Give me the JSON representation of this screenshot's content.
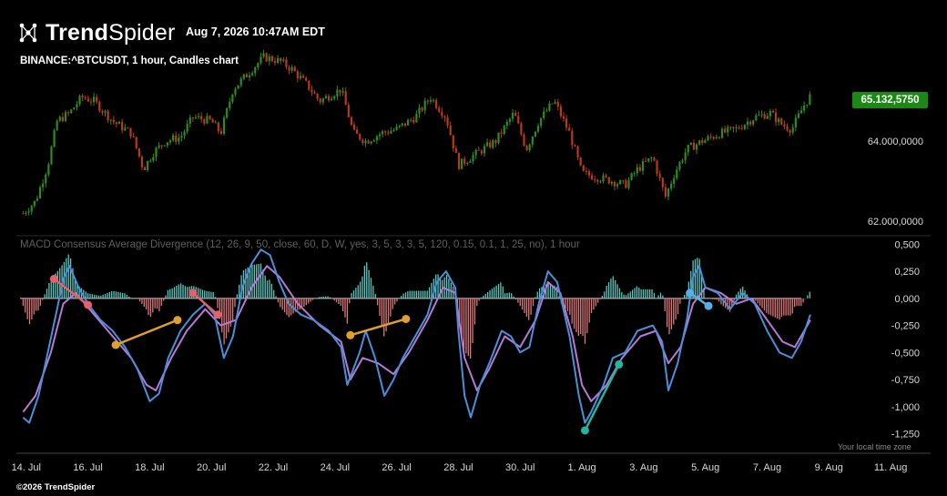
{
  "header": {
    "brand_bold": "Trend",
    "brand_light": "Spider",
    "brand_icon": "network-nodes-icon",
    "datetime": "Aug 7, 2026 10:47AM EDT",
    "symbol_title": "BINANCE:^BTCUSDT, 1 hour, Candles chart"
  },
  "footer": {
    "timezone_note": "Your local time zone",
    "copyright": "©2026 TrendSpider"
  },
  "colors": {
    "background": "#000000",
    "candle_up": "#2e8b1d",
    "candle_down": "#b83a1a",
    "hist_positive": "#59c9c0",
    "hist_negative": "#e0787a",
    "macd_line": "#4a90d9",
    "signal_line": "#b879d6",
    "price_badge": "#1b8a14",
    "div_red": "#e4606e",
    "div_orange": "#e0a030",
    "div_teal": "#23b59d",
    "div_blue": "#5aaee8"
  },
  "chart_data": [
    {
      "type": "candlestick",
      "title": "BINANCE:^BTCUSDT, 1 hour, Candles chart",
      "y_axis_side": "right",
      "y_ticks": [
        "64.000,0000",
        "62.000,0000"
      ],
      "y_tick_values": [
        64000,
        62000
      ],
      "ylim": [
        61800,
        66500
      ],
      "last_price_label": "65.132,5750",
      "last_price": 65132.575,
      "x_ticks": [
        "14. Jul",
        "16. Jul",
        "18. Jul",
        "20. Jul",
        "22. Jul",
        "24. Jul",
        "26. Jul",
        "28. Jul",
        "30. Jul",
        "1. Aug",
        "3. Aug",
        "5. Aug",
        "7. Aug",
        "9. Aug",
        "11. Aug"
      ],
      "x_tick_days": [
        0,
        2,
        4,
        6,
        8,
        10,
        12,
        14,
        16,
        18,
        20,
        22,
        24,
        26,
        28
      ],
      "x_range_days": [
        -0.2,
        29
      ],
      "close_path": [
        {
          "day": -0.1,
          "close": 62200
        },
        {
          "day": 0.3,
          "close": 62500
        },
        {
          "day": 0.7,
          "close": 63400
        },
        {
          "day": 1.0,
          "close": 64500
        },
        {
          "day": 1.4,
          "close": 64700
        },
        {
          "day": 1.8,
          "close": 65100
        },
        {
          "day": 2.2,
          "close": 65000
        },
        {
          "day": 2.8,
          "close": 64500
        },
        {
          "day": 3.4,
          "close": 64200
        },
        {
          "day": 3.8,
          "close": 63300
        },
        {
          "day": 4.1,
          "close": 63700
        },
        {
          "day": 4.5,
          "close": 64000
        },
        {
          "day": 5.0,
          "close": 64100
        },
        {
          "day": 5.4,
          "close": 64600
        },
        {
          "day": 6.0,
          "close": 64500
        },
        {
          "day": 6.3,
          "close": 64200
        },
        {
          "day": 6.7,
          "close": 65300
        },
        {
          "day": 7.2,
          "close": 65700
        },
        {
          "day": 7.7,
          "close": 66100
        },
        {
          "day": 8.2,
          "close": 66000
        },
        {
          "day": 8.6,
          "close": 65800
        },
        {
          "day": 9.1,
          "close": 65400
        },
        {
          "day": 9.5,
          "close": 65000
        },
        {
          "day": 10.2,
          "close": 65300
        },
        {
          "day": 10.6,
          "close": 64200
        },
        {
          "day": 11.0,
          "close": 64000
        },
        {
          "day": 11.5,
          "close": 64200
        },
        {
          "day": 12.0,
          "close": 64300
        },
        {
          "day": 12.6,
          "close": 64600
        },
        {
          "day": 13.1,
          "close": 65100
        },
        {
          "day": 13.6,
          "close": 64600
        },
        {
          "day": 14.0,
          "close": 63400
        },
        {
          "day": 14.6,
          "close": 63700
        },
        {
          "day": 15.2,
          "close": 64000
        },
        {
          "day": 15.8,
          "close": 64700
        },
        {
          "day": 16.2,
          "close": 63800
        },
        {
          "day": 16.6,
          "close": 64500
        },
        {
          "day": 17.1,
          "close": 65000
        },
        {
          "day": 17.6,
          "close": 64200
        },
        {
          "day": 18.0,
          "close": 63200
        },
        {
          "day": 18.5,
          "close": 63100
        },
        {
          "day": 19.0,
          "close": 63000
        },
        {
          "day": 19.4,
          "close": 62900
        },
        {
          "day": 19.8,
          "close": 63300
        },
        {
          "day": 20.3,
          "close": 63600
        },
        {
          "day": 20.7,
          "close": 62600
        },
        {
          "day": 21.0,
          "close": 63200
        },
        {
          "day": 21.4,
          "close": 63800
        },
        {
          "day": 21.9,
          "close": 64000
        },
        {
          "day": 22.5,
          "close": 64200
        },
        {
          "day": 23.0,
          "close": 64300
        },
        {
          "day": 23.6,
          "close": 64600
        },
        {
          "day": 24.1,
          "close": 64700
        },
        {
          "day": 24.5,
          "close": 64400
        },
        {
          "day": 24.8,
          "close": 64300
        },
        {
          "day": 25.2,
          "close": 64900
        },
        {
          "day": 25.4,
          "close": 65132
        }
      ]
    },
    {
      "type": "line",
      "title": "MACD Consensus Average Divergence (12, 26, 9, 50, close, 60, D, W, yes, 3, 5, 3, 3, 5, 120, 0.15, 0.1, 1, 25, no), 1 hour",
      "y_axis_side": "right",
      "y_ticks": [
        "0,500",
        "0,250",
        "0,000",
        "-0,250",
        "-0,500",
        "-0,750",
        "-1,000",
        "-1,250"
      ],
      "y_tick_values": [
        0.5,
        0.25,
        0,
        -0.25,
        -0.5,
        -0.75,
        -1.0,
        -1.25
      ],
      "ylim": [
        -1.38,
        0.52
      ],
      "series": [
        {
          "role": "macd",
          "points": [
            {
              "day": -0.1,
              "value": -1.1
            },
            {
              "day": 0.1,
              "value": -1.15
            },
            {
              "day": 0.4,
              "value": -0.9
            },
            {
              "day": 0.7,
              "value": -0.5
            },
            {
              "day": 1.0,
              "value": -0.1
            },
            {
              "day": 1.2,
              "value": 0.18
            },
            {
              "day": 1.4,
              "value": 0.3
            },
            {
              "day": 1.7,
              "value": 0.1
            },
            {
              "day": 2.0,
              "value": -0.05
            },
            {
              "day": 2.4,
              "value": -0.2
            },
            {
              "day": 2.8,
              "value": -0.3
            },
            {
              "day": 3.2,
              "value": -0.45
            },
            {
              "day": 3.6,
              "value": -0.65
            },
            {
              "day": 4.0,
              "value": -0.95
            },
            {
              "day": 4.3,
              "value": -0.88
            },
            {
              "day": 4.6,
              "value": -0.55
            },
            {
              "day": 5.0,
              "value": -0.3
            },
            {
              "day": 5.4,
              "value": -0.15
            },
            {
              "day": 5.8,
              "value": -0.05
            },
            {
              "day": 6.1,
              "value": -0.15
            },
            {
              "day": 6.4,
              "value": -0.55
            },
            {
              "day": 6.7,
              "value": -0.35
            },
            {
              "day": 7.0,
              "value": 0.1
            },
            {
              "day": 7.3,
              "value": 0.32
            },
            {
              "day": 7.6,
              "value": 0.45
            },
            {
              "day": 7.9,
              "value": 0.4
            },
            {
              "day": 8.2,
              "value": 0.15
            },
            {
              "day": 8.5,
              "value": -0.05
            },
            {
              "day": 8.9,
              "value": -0.15
            },
            {
              "day": 9.3,
              "value": -0.2
            },
            {
              "day": 9.8,
              "value": -0.3
            },
            {
              "day": 10.2,
              "value": -0.45
            },
            {
              "day": 10.4,
              "value": -0.8
            },
            {
              "day": 10.8,
              "value": -0.5
            },
            {
              "day": 11.0,
              "value": -0.3
            },
            {
              "day": 11.3,
              "value": -0.55
            },
            {
              "day": 11.6,
              "value": -0.9
            },
            {
              "day": 11.9,
              "value": -0.75
            },
            {
              "day": 12.2,
              "value": -0.55
            },
            {
              "day": 12.6,
              "value": -0.35
            },
            {
              "day": 13.0,
              "value": -0.15
            },
            {
              "day": 13.3,
              "value": 0.15
            },
            {
              "day": 13.6,
              "value": 0.25
            },
            {
              "day": 13.9,
              "value": 0.1
            },
            {
              "day": 14.0,
              "value": -0.3
            },
            {
              "day": 14.2,
              "value": -0.9
            },
            {
              "day": 14.4,
              "value": -1.1
            },
            {
              "day": 14.7,
              "value": -0.8
            },
            {
              "day": 15.0,
              "value": -0.6
            },
            {
              "day": 15.4,
              "value": -0.3
            },
            {
              "day": 15.7,
              "value": -0.35
            },
            {
              "day": 16.0,
              "value": -0.5
            },
            {
              "day": 16.3,
              "value": -0.45
            },
            {
              "day": 16.6,
              "value": -0.05
            },
            {
              "day": 16.9,
              "value": 0.25
            },
            {
              "day": 17.2,
              "value": 0.15
            },
            {
              "day": 17.4,
              "value": -0.1
            },
            {
              "day": 17.6,
              "value": -0.35
            },
            {
              "day": 17.9,
              "value": -0.9
            },
            {
              "day": 18.1,
              "value": -1.15
            },
            {
              "day": 18.3,
              "value": -1.05
            },
            {
              "day": 18.7,
              "value": -0.8
            },
            {
              "day": 19.0,
              "value": -0.55
            },
            {
              "day": 19.4,
              "value": -0.5
            },
            {
              "day": 19.8,
              "value": -0.3
            },
            {
              "day": 20.3,
              "value": -0.25
            },
            {
              "day": 20.6,
              "value": -0.4
            },
            {
              "day": 20.8,
              "value": -0.85
            },
            {
              "day": 21.1,
              "value": -0.6
            },
            {
              "day": 21.4,
              "value": -0.2
            },
            {
              "day": 21.6,
              "value": 0.2
            },
            {
              "day": 21.8,
              "value": 0.3
            },
            {
              "day": 22.0,
              "value": 0.1
            },
            {
              "day": 22.4,
              "value": 0.05
            },
            {
              "day": 22.8,
              "value": -0.1
            },
            {
              "day": 23.2,
              "value": 0.05
            },
            {
              "day": 23.6,
              "value": -0.05
            },
            {
              "day": 24.0,
              "value": -0.3
            },
            {
              "day": 24.4,
              "value": -0.5
            },
            {
              "day": 24.8,
              "value": -0.55
            },
            {
              "day": 25.1,
              "value": -0.4
            },
            {
              "day": 25.4,
              "value": -0.15
            }
          ]
        },
        {
          "role": "signal",
          "points": [
            {
              "day": -0.1,
              "value": -1.05
            },
            {
              "day": 0.3,
              "value": -0.9
            },
            {
              "day": 0.8,
              "value": -0.5
            },
            {
              "day": 1.2,
              "value": -0.05
            },
            {
              "day": 1.6,
              "value": 0.05
            },
            {
              "day": 2.2,
              "value": -0.15
            },
            {
              "day": 2.8,
              "value": -0.35
            },
            {
              "day": 3.4,
              "value": -0.55
            },
            {
              "day": 3.9,
              "value": -0.8
            },
            {
              "day": 4.2,
              "value": -0.85
            },
            {
              "day": 4.7,
              "value": -0.55
            },
            {
              "day": 5.2,
              "value": -0.3
            },
            {
              "day": 5.8,
              "value": -0.1
            },
            {
              "day": 6.3,
              "value": -0.25
            },
            {
              "day": 6.8,
              "value": -0.2
            },
            {
              "day": 7.3,
              "value": 0.1
            },
            {
              "day": 7.8,
              "value": 0.3
            },
            {
              "day": 8.2,
              "value": 0.2
            },
            {
              "day": 8.8,
              "value": -0.05
            },
            {
              "day": 9.5,
              "value": -0.25
            },
            {
              "day": 10.2,
              "value": -0.4
            },
            {
              "day": 10.5,
              "value": -0.75
            },
            {
              "day": 10.9,
              "value": -0.55
            },
            {
              "day": 11.4,
              "value": -0.6
            },
            {
              "day": 11.9,
              "value": -0.7
            },
            {
              "day": 12.4,
              "value": -0.5
            },
            {
              "day": 13.0,
              "value": -0.2
            },
            {
              "day": 13.5,
              "value": 0.1
            },
            {
              "day": 13.9,
              "value": 0.05
            },
            {
              "day": 14.2,
              "value": -0.55
            },
            {
              "day": 14.6,
              "value": -0.85
            },
            {
              "day": 15.0,
              "value": -0.65
            },
            {
              "day": 15.5,
              "value": -0.35
            },
            {
              "day": 16.0,
              "value": -0.45
            },
            {
              "day": 16.5,
              "value": -0.2
            },
            {
              "day": 16.9,
              "value": 0.15
            },
            {
              "day": 17.3,
              "value": 0.05
            },
            {
              "day": 17.7,
              "value": -0.35
            },
            {
              "day": 18.0,
              "value": -0.8
            },
            {
              "day": 18.3,
              "value": -0.95
            },
            {
              "day": 18.8,
              "value": -0.8
            },
            {
              "day": 19.3,
              "value": -0.55
            },
            {
              "day": 19.9,
              "value": -0.35
            },
            {
              "day": 20.4,
              "value": -0.3
            },
            {
              "day": 20.8,
              "value": -0.6
            },
            {
              "day": 21.2,
              "value": -0.45
            },
            {
              "day": 21.6,
              "value": -0.05
            },
            {
              "day": 22.0,
              "value": 0.1
            },
            {
              "day": 22.5,
              "value": 0.05
            },
            {
              "day": 23.0,
              "value": -0.05
            },
            {
              "day": 23.5,
              "value": 0.0
            },
            {
              "day": 24.0,
              "value": -0.2
            },
            {
              "day": 24.5,
              "value": -0.4
            },
            {
              "day": 24.9,
              "value": -0.45
            },
            {
              "day": 25.2,
              "value": -0.3
            },
            {
              "day": 25.4,
              "value": -0.2
            }
          ]
        }
      ],
      "divergence_markers": [
        {
          "color_key": "div_red",
          "from": {
            "day": 0.9,
            "value": 0.18
          },
          "to": {
            "day": 2.0,
            "value": -0.06
          }
        },
        {
          "color_key": "div_orange",
          "from": {
            "day": 2.9,
            "value": -0.43
          },
          "to": {
            "day": 4.9,
            "value": -0.2
          }
        },
        {
          "color_key": "div_red",
          "from": {
            "day": 5.4,
            "value": 0.05
          },
          "to": {
            "day": 6.2,
            "value": -0.15
          }
        },
        {
          "color_key": "div_orange",
          "from": {
            "day": 10.5,
            "value": -0.34
          },
          "to": {
            "day": 12.3,
            "value": -0.19
          }
        },
        {
          "color_key": "div_teal",
          "from": {
            "day": 18.1,
            "value": -1.22
          },
          "to": {
            "day": 19.2,
            "value": -0.61
          }
        },
        {
          "color_key": "div_blue",
          "from": {
            "day": 21.5,
            "value": 0.05
          },
          "to": {
            "day": 22.1,
            "value": -0.07
          }
        }
      ]
    }
  ]
}
